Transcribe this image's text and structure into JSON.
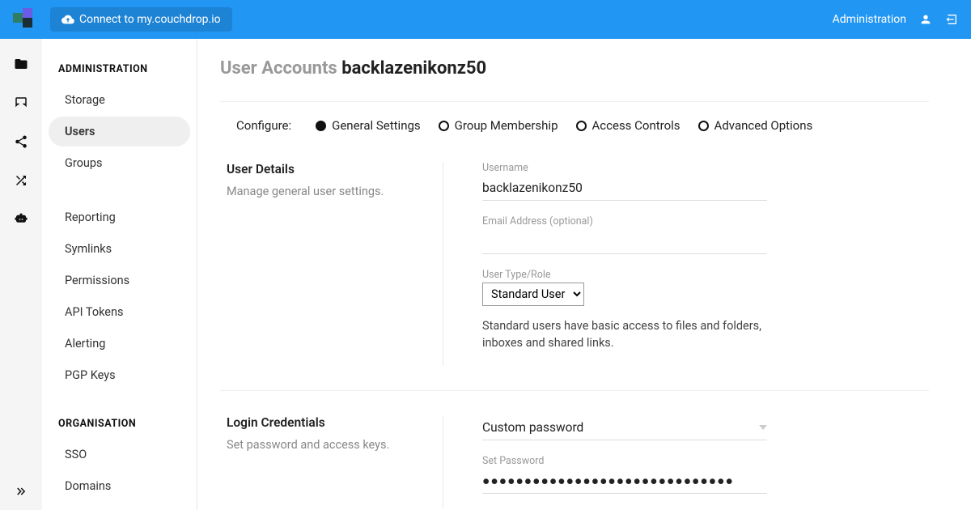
{
  "topbar": {
    "connect_label": "Connect to my.couchdrop.io",
    "admin_link": "Administration"
  },
  "sidebar": {
    "heading_admin": "ADMINISTRATION",
    "heading_org": "ORGANISATION",
    "items_admin": [
      "Storage",
      "Users",
      "Groups",
      "Reporting",
      "Symlinks",
      "Permissions",
      "API Tokens",
      "Alerting",
      "PGP Keys"
    ],
    "items_org": [
      "SSO",
      "Domains"
    ],
    "active": "Users"
  },
  "page": {
    "title_prefix": "User Accounts ",
    "title_strong": "backlazenikonz50"
  },
  "tabs": {
    "configure_label": "Configure:",
    "items": [
      "General Settings",
      "Group Membership",
      "Access Controls",
      "Advanced Options"
    ],
    "active": "General Settings"
  },
  "user_details": {
    "title": "User Details",
    "desc": "Manage general user settings.",
    "username_label": "Username",
    "username_value": "backlazenikonz50",
    "email_label": "Email Address (optional)",
    "email_value": "",
    "role_label": "User Type/Role",
    "role_value": "Standard User",
    "role_help": "Standard users have basic access to files and folders, inboxes and shared links."
  },
  "login": {
    "title": "Login Credentials",
    "desc": "Set password and access keys.",
    "mode_label": "Custom password",
    "set_password_label": "Set Password",
    "password_value": "●●●●●●●●●●●●●●●●●●●●●●●●●●●●●●"
  }
}
